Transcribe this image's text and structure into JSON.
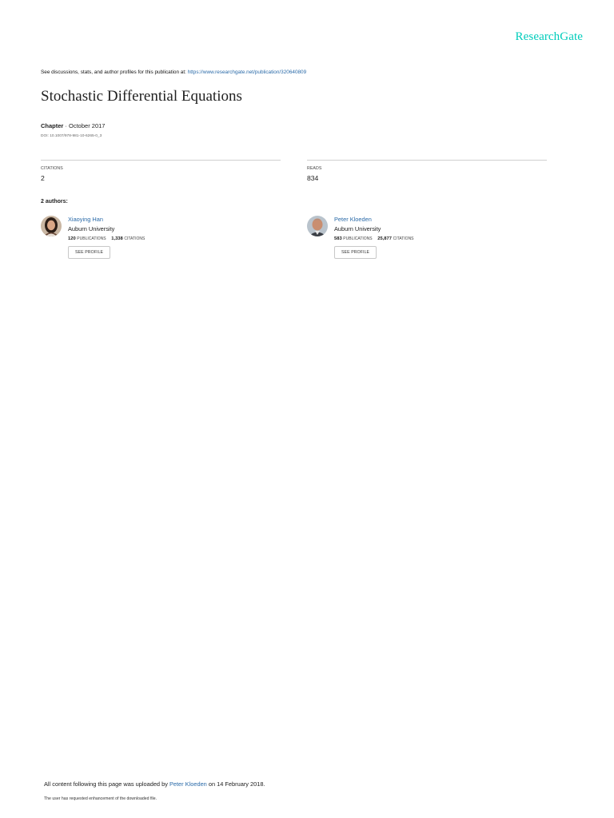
{
  "brand": {
    "logo": "ResearchGate",
    "color": "#00ccbb"
  },
  "header": {
    "discuss_text": "See discussions, stats, and author profiles for this publication at: ",
    "publication_url": "https://www.researchgate.net/publication/320640809"
  },
  "publication": {
    "title": "Stochastic Differential Equations",
    "type": "Chapter",
    "date": " · October 2017",
    "doi": "DOI: 10.1007/978-981-10-6265-0_3"
  },
  "stats": {
    "citations_label": "CITATIONS",
    "citations_value": "2",
    "reads_label": "READS",
    "reads_value": "834"
  },
  "authors_heading": "2 authors:",
  "authors": [
    {
      "name": "Xiaoying Han",
      "institution": "Auburn University",
      "publications": "120",
      "publications_label": "PUBLICATIONS",
      "citations": "1,338",
      "citations_label": "CITATIONS",
      "button": "SEE PROFILE",
      "avatar_icon": "author-photo-icon"
    },
    {
      "name": "Peter Kloeden",
      "institution": "Auburn University",
      "publications": "583",
      "publications_label": "PUBLICATIONS",
      "citations": "25,877",
      "citations_label": "CITATIONS",
      "button": "SEE PROFILE",
      "avatar_icon": "author-photo-icon"
    }
  ],
  "footer": {
    "uploaded_prefix": "All content following this page was uploaded by ",
    "uploader": "Peter Kloeden",
    "uploaded_suffix": " on 14 February 2018.",
    "enhancement_note": "The user has requested enhancement of the downloaded file."
  },
  "colors": {
    "link": "#2a6aa8",
    "rule": "#cfcfcf"
  }
}
